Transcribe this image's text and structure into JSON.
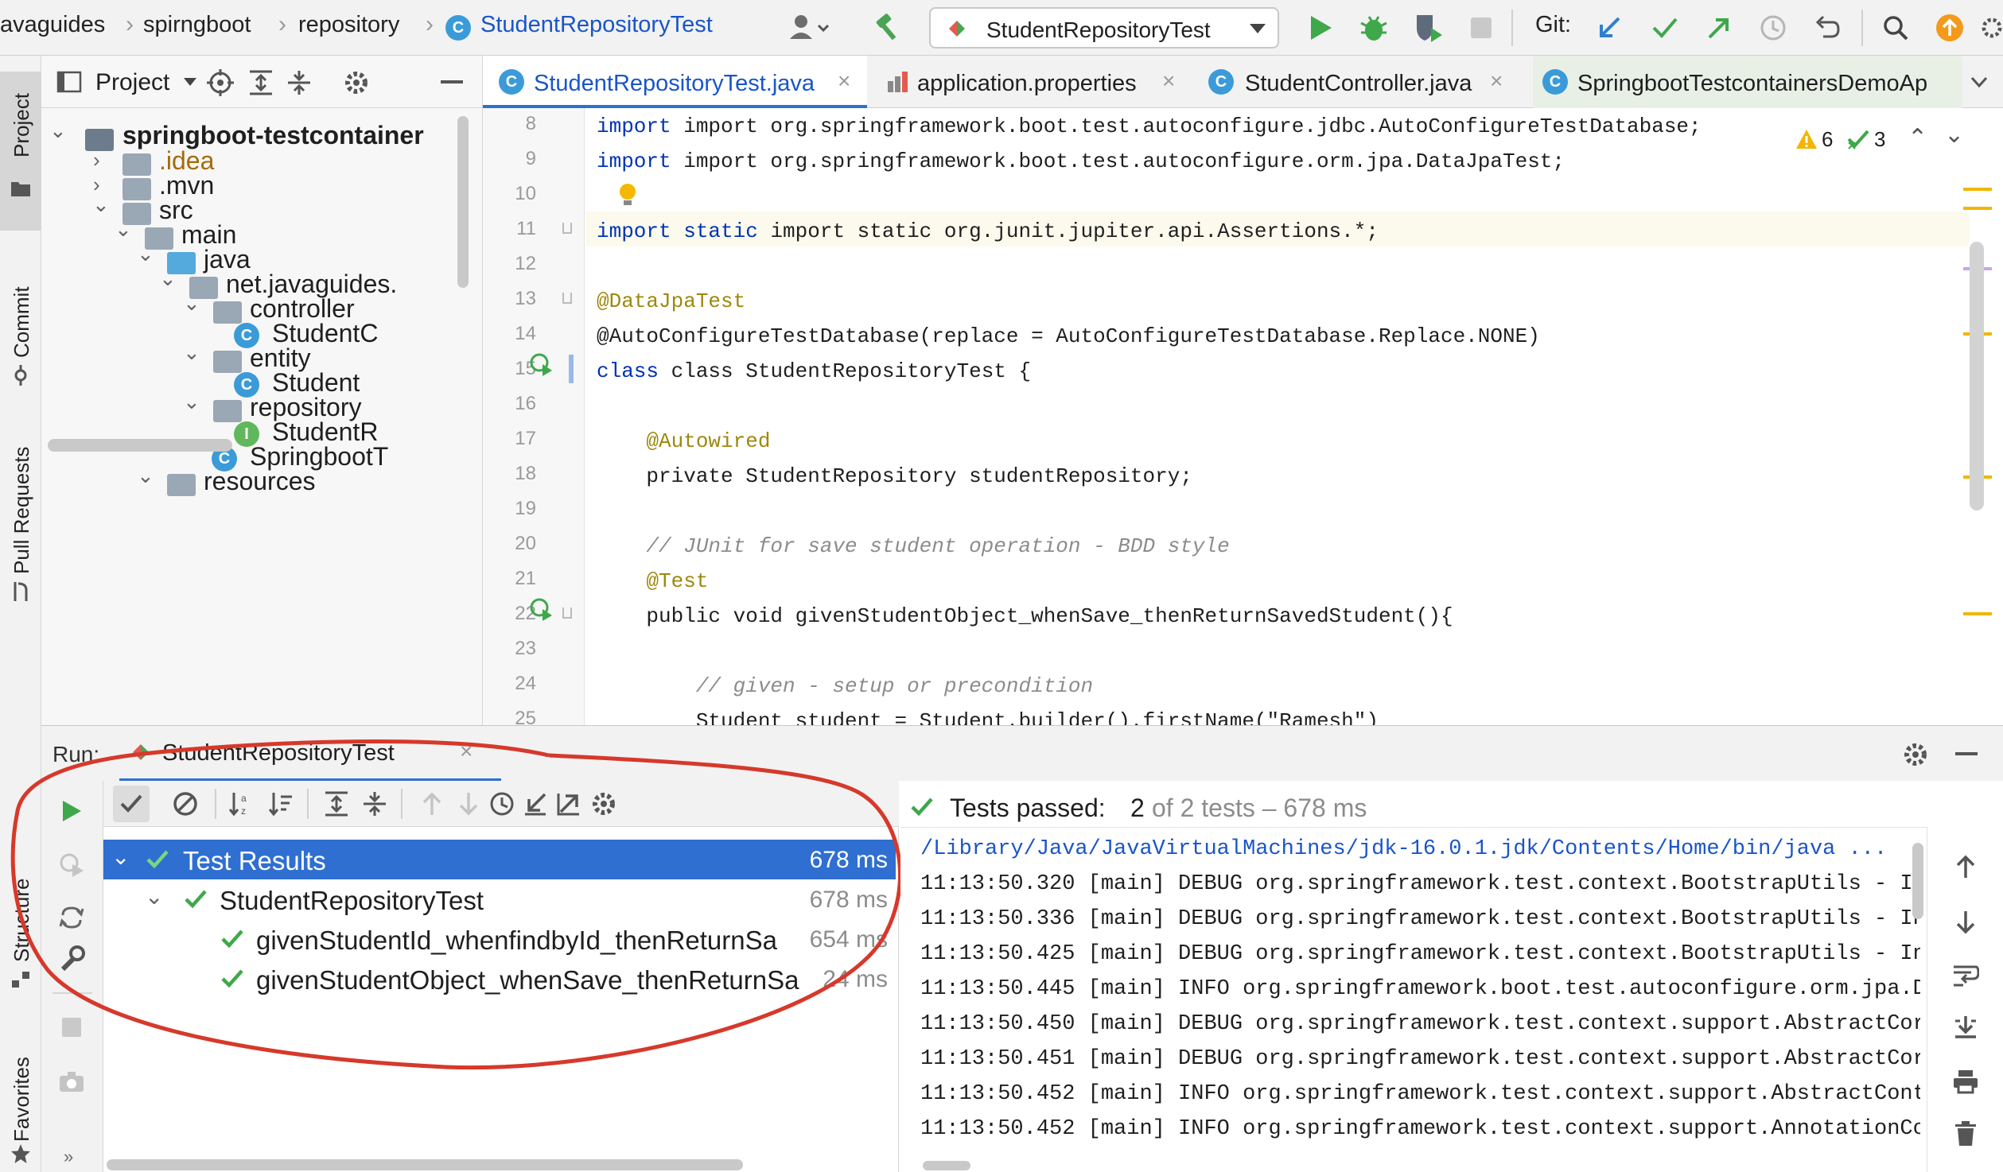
{
  "breadcrumb": [
    "avaguides",
    "spirngboot",
    "repository",
    "StudentRepositoryTest"
  ],
  "run_config": "StudentRepositoryTest",
  "git_label": "Git:",
  "project_panel": {
    "title": "Project",
    "tree": [
      {
        "label": "springboot-testcontainer",
        "depth": 0,
        "type": "module",
        "expanded": true
      },
      {
        "label": ".idea",
        "depth": 1,
        "type": "folder",
        "expanded": false
      },
      {
        "label": ".mvn",
        "depth": 1,
        "type": "folder",
        "expanded": false
      },
      {
        "label": "src",
        "depth": 1,
        "type": "folder",
        "expanded": true
      },
      {
        "label": "main",
        "depth": 2,
        "type": "folder",
        "expanded": true
      },
      {
        "label": "java",
        "depth": 3,
        "type": "source-folder",
        "expanded": true
      },
      {
        "label": "net.javaguides.",
        "depth": 4,
        "type": "package",
        "expanded": true
      },
      {
        "label": "controller",
        "depth": 5,
        "type": "package",
        "expanded": true
      },
      {
        "label": "StudentC",
        "depth": 6,
        "type": "class"
      },
      {
        "label": "entity",
        "depth": 5,
        "type": "package",
        "expanded": true
      },
      {
        "label": "Student",
        "depth": 6,
        "type": "class"
      },
      {
        "label": "repository",
        "depth": 5,
        "type": "package",
        "expanded": true
      },
      {
        "label": "StudentR",
        "depth": 6,
        "type": "interface"
      },
      {
        "label": "SpringbootT",
        "depth": 5,
        "type": "app-class"
      },
      {
        "label": "resources",
        "depth": 3,
        "type": "resources-folder",
        "expanded": true
      }
    ]
  },
  "editor_tabs": [
    {
      "label": "StudentRepositoryTest.java",
      "active": true,
      "icon": "class-icon"
    },
    {
      "label": "application.properties",
      "active": false,
      "icon": "properties-icon"
    },
    {
      "label": "StudentController.java",
      "active": false,
      "icon": "class-icon"
    },
    {
      "label": "SpringbootTestcontainersDemoAp",
      "active": false,
      "icon": "app-class-icon"
    }
  ],
  "inspections": {
    "warnings": "6",
    "weak_warnings": "3"
  },
  "code_lines": [
    {
      "n": "8",
      "text": "import org.springframework.boot.test.autoconfigure.jdbc.AutoConfigureTestDatabase;"
    },
    {
      "n": "9",
      "text": "import org.springframework.boot.test.autoconfigure.orm.jpa.DataJpaTest;"
    },
    {
      "n": "10",
      "text": ""
    },
    {
      "n": "11",
      "text": "import static org.junit.jupiter.api.Assertions.*;"
    },
    {
      "n": "12",
      "text": ""
    },
    {
      "n": "13",
      "text": "@DataJpaTest"
    },
    {
      "n": "14",
      "text": "@AutoConfigureTestDatabase(replace = AutoConfigureTestDatabase.Replace.NONE)"
    },
    {
      "n": "15",
      "text": "class StudentRepositoryTest {"
    },
    {
      "n": "16",
      "text": ""
    },
    {
      "n": "17",
      "text": "    @Autowired"
    },
    {
      "n": "18",
      "text": "    private StudentRepository studentRepository;"
    },
    {
      "n": "19",
      "text": ""
    },
    {
      "n": "20",
      "text": "    // JUnit for save student operation - BDD style"
    },
    {
      "n": "21",
      "text": "    @Test"
    },
    {
      "n": "22",
      "text": "    public void givenStudentObject_whenSave_thenReturnSavedStudent(){"
    },
    {
      "n": "23",
      "text": ""
    },
    {
      "n": "24",
      "text": "        // given - setup or precondition"
    },
    {
      "n": "25",
      "text": "        Student student = Student.builder().firstName(\"Ramesh\")"
    }
  ],
  "run_panel": {
    "label": "Run:",
    "tab": "StudentRepositoryTest",
    "status_prefix": "Tests passed:",
    "status_count": "2",
    "status_suffix": "of 2 tests – 678 ms",
    "tests": [
      {
        "label": "Test Results",
        "time": "678 ms",
        "depth": 0,
        "selected": true
      },
      {
        "label": "StudentRepositoryTest",
        "time": "678 ms",
        "depth": 1,
        "selected": false
      },
      {
        "label": "givenStudentId_whenfindbyId_thenReturnSa",
        "time": "654 ms",
        "depth": 2,
        "selected": false
      },
      {
        "label": "givenStudentObject_whenSave_thenReturnSa",
        "time": "24 ms",
        "depth": 2,
        "selected": false
      }
    ],
    "console": [
      "/Library/Java/JavaVirtualMachines/jdk-16.0.1.jdk/Contents/Home/bin/java ...",
      "11:13:50.320 [main] DEBUG org.springframework.test.context.BootstrapUtils - In",
      "11:13:50.336 [main] DEBUG org.springframework.test.context.BootstrapUtils - In",
      "11:13:50.425 [main] DEBUG org.springframework.test.context.BootstrapUtils - In",
      "11:13:50.445 [main] INFO org.springframework.boot.test.autoconfigure.orm.jpa.D",
      "11:13:50.450 [main] DEBUG org.springframework.test.context.support.AbstractCor",
      "11:13:50.451 [main] DEBUG org.springframework.test.context.support.AbstractCor",
      "11:13:50.452 [main] INFO org.springframework.test.context.support.AbstractCont",
      "11:13:50.452 [main] INFO org.springframework.test.context.support.AnnotationCo"
    ]
  },
  "side_labels": {
    "project": "Project",
    "commit": "Commit",
    "pull_requests": "Pull Requests",
    "structure": "Structure",
    "favorites": "Favorites"
  },
  "colors": {
    "accent": "#2f6fd1",
    "pass_green": "#3ea84a",
    "annotation_red": "#d6392b",
    "run_green": "#3ea84a"
  }
}
